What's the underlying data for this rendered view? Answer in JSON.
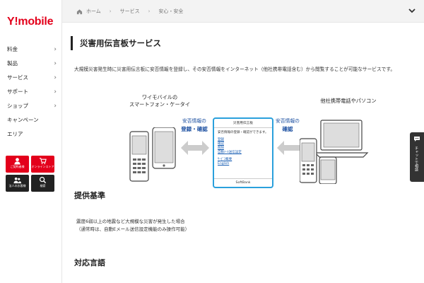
{
  "brand": {
    "logo_y": "Y!",
    "logo_text": "mobile",
    "color": "#e3001b"
  },
  "sidebar": {
    "items": [
      {
        "label": "料金"
      },
      {
        "label": "製品"
      },
      {
        "label": "サービス"
      },
      {
        "label": "サポート"
      },
      {
        "label": "ショップ"
      },
      {
        "label": "キャンペーン"
      },
      {
        "label": "エリア"
      }
    ],
    "tiles": [
      {
        "label": "ご契約者様",
        "icon": "user-icon"
      },
      {
        "label": "オンラインストア",
        "icon": "cart-icon"
      },
      {
        "label": "法人のお客様",
        "icon": "users-icon"
      },
      {
        "label": "検索",
        "icon": "search-icon"
      }
    ]
  },
  "breadcrumb": {
    "items": [
      "ホーム",
      "サービス",
      "安心・安全"
    ]
  },
  "main": {
    "title": "災害用伝言板サービス",
    "intro": "大規模災害発生時に災害用伝言板に安否情報を登録し、その安否情報をインターネット（他社携帯電話含む）から閲覧することが可能なサービスです。",
    "diagram": {
      "left_label": "ワイモバイルの\nスマートフォン・ケータイ",
      "left_info_top": "安否情報の",
      "left_info_bottom": "登録・確認",
      "right_label": "他社携帯電話やパソコン",
      "right_info_top": "安否情報の",
      "right_info_bottom": "確認",
      "card": {
        "title": "災害用伝言板",
        "text": "安否情報の登録・確認ができます。",
        "links": [
          "登録",
          "確認",
          "削除",
          "自動ﾒｰﾙ送信設定"
        ],
        "links2": [
          "ｻｰﾋﾞｽ概要",
          "English"
        ],
        "footer": "SoftBank"
      }
    },
    "sections": [
      {
        "title": "提供基準",
        "lines": [
          "震度6弱以上の地震など大規模な災害が発生した場合",
          "（通常時は、自動Eメール送信設定機能のみ操作可能）"
        ]
      },
      {
        "title": "対応言語"
      }
    ]
  },
  "chat": {
    "label": "チャットで相談"
  }
}
